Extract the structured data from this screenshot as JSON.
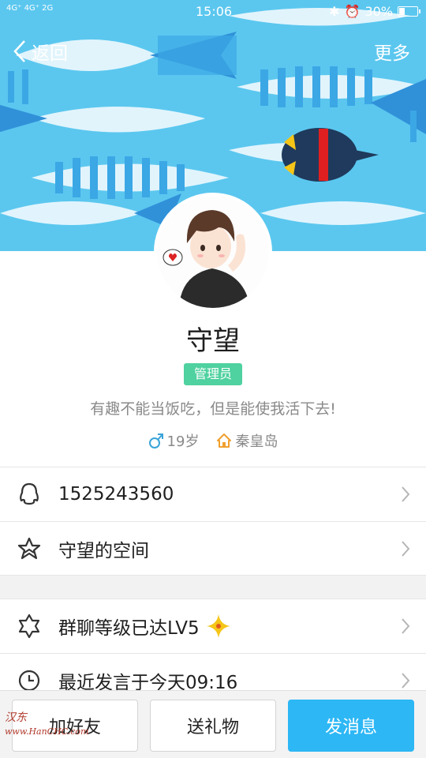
{
  "status_bar": {
    "network_left": "4G⁺ 4G⁺ 2G",
    "time": "15:06",
    "battery_text": "30%",
    "battery_level": 0.3
  },
  "nav": {
    "back_label": "返回",
    "more_label": "更多"
  },
  "profile": {
    "name": "守望",
    "role_badge": "管理员",
    "signature": "有趣不能当饭吃，但是能使我活下去!",
    "gender_age": "19岁",
    "location": "秦皇岛"
  },
  "rows": [
    {
      "icon": "qq-penguin-icon",
      "label": "1525243560"
    },
    {
      "icon": "star-outline-icon",
      "label": "守望的空间"
    },
    {
      "icon": "star-badge-icon",
      "label": "群聊等级已达LV5"
    },
    {
      "icon": "clock-icon",
      "label": "最近发言于今天09:16"
    }
  ],
  "buttons": {
    "add_friend": "加好友",
    "send_gift": "送礼物",
    "send_message": "发消息"
  },
  "watermark": {
    "text": "汉东",
    "url": "www.HanCHC.com"
  },
  "colors": {
    "banner_bg": "#5bc7ef",
    "accent": "#2db7f5",
    "badge": "#4fd1a0",
    "gender": "#3aa4d8",
    "location": "#f0a030"
  }
}
